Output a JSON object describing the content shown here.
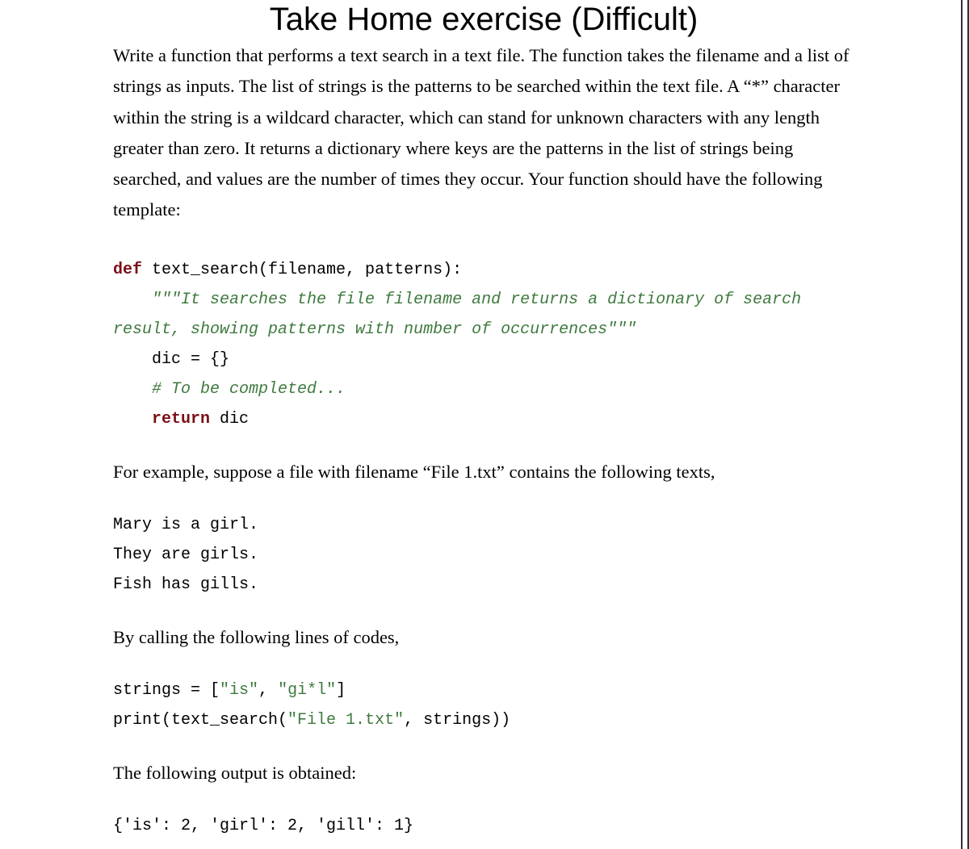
{
  "title": "Take Home exercise (Difficult)",
  "intro": "Write a function that performs a text search in a text file. The function takes the filename and a list of strings as inputs. The list of strings is the patterns to be searched within the text file. A “*” character within the string is a wildcard character, which can stand for unknown characters with any length greater than zero. It returns a dictionary where keys are the patterns in the list of strings being searched, and values are the number of times they occur. Your function should have the following template:",
  "code1": {
    "kw_def": "def",
    "sig": " text_search(filename, patterns):",
    "doc_open": "    \"\"\"",
    "doc_l1": "It searches the file filename and returns a dictionary of search ",
    "doc_l2": "result, showing patterns with number of occurrences",
    "doc_close": "\"\"\"",
    "dic_line": "    dic = {}",
    "todo_line": "    # To be completed...",
    "kw_return": "    return",
    "return_var": " dic"
  },
  "para_example_intro": "For example, suppose a file with filename “File 1.txt” contains the following texts,",
  "file_contents": "Mary is a girl.\nThey are girls.\nFish has gills.",
  "para_call": "By calling the following lines of codes,",
  "code2": {
    "l1_a": "strings = [",
    "l1_s1": "\"is\"",
    "l1_comma": ", ",
    "l1_s2": "\"gi*l\"",
    "l1_close": "]",
    "l2_a": "print(text_search(",
    "l2_s1": "\"File 1.txt\"",
    "l2_b": ", strings))"
  },
  "para_output_intro": "The following output is obtained:",
  "output_line": "{'is': 2, 'girl': 2, 'gill': 1}"
}
